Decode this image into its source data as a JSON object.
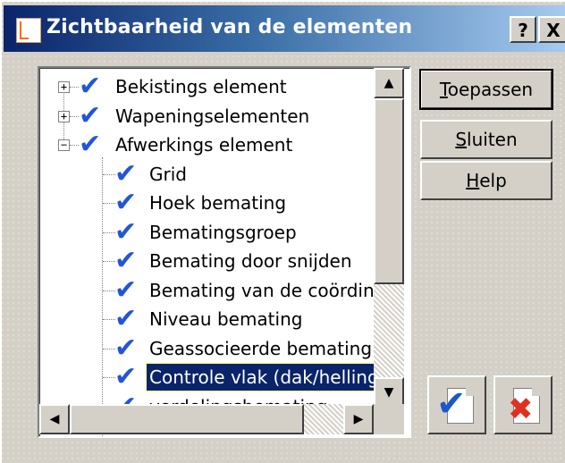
{
  "window": {
    "title": "Zichtbaarheid van de elementen",
    "help_glyph": "?",
    "close_glyph": "X",
    "icon": "app-layout-icon"
  },
  "tree": {
    "items": [
      {
        "label": "Bekistings element",
        "level": 0,
        "expander": "+",
        "checked": true
      },
      {
        "label": "Wapeningselementen",
        "level": 0,
        "expander": "+",
        "checked": true
      },
      {
        "label": "Afwerkings element",
        "level": 0,
        "expander": "−",
        "checked": true
      },
      {
        "label": "Grid",
        "level": 1,
        "checked": true
      },
      {
        "label": "Hoek bemating",
        "level": 1,
        "checked": true
      },
      {
        "label": "Bematingsgroep",
        "level": 1,
        "checked": true
      },
      {
        "label": "Bemating door snijden",
        "level": 1,
        "checked": true
      },
      {
        "label": "Bemating van de coördinat",
        "level": 1,
        "checked": true
      },
      {
        "label": "Niveau bemating",
        "level": 1,
        "checked": true
      },
      {
        "label": "Geassocieerde bemating",
        "level": 1,
        "checked": true
      },
      {
        "label": "Controle vlak (dak/helling/",
        "level": 1,
        "checked": true,
        "selected": true
      },
      {
        "label": "verdelingsbemating",
        "level": 1,
        "checked": true
      }
    ],
    "check_glyph": "✔"
  },
  "scrollbars": {
    "up": "▲",
    "down": "▼",
    "left": "◀",
    "right": "▶"
  },
  "buttons": {
    "apply": {
      "underline": "T",
      "rest": "oepassen"
    },
    "close": {
      "underline": "S",
      "rest": "luiten"
    },
    "help": {
      "underline": "H",
      "rest": "elp"
    }
  },
  "icon_buttons": {
    "check_all_icon": "check-all-icon",
    "uncheck_all_icon": "uncheck-all-icon",
    "check_glyph": "✔",
    "x_glyph": "✖"
  },
  "colors": {
    "title_start": "#0a246a",
    "title_end": "#a6caf0",
    "selection": "#0a246a",
    "check": "#2255d8"
  }
}
